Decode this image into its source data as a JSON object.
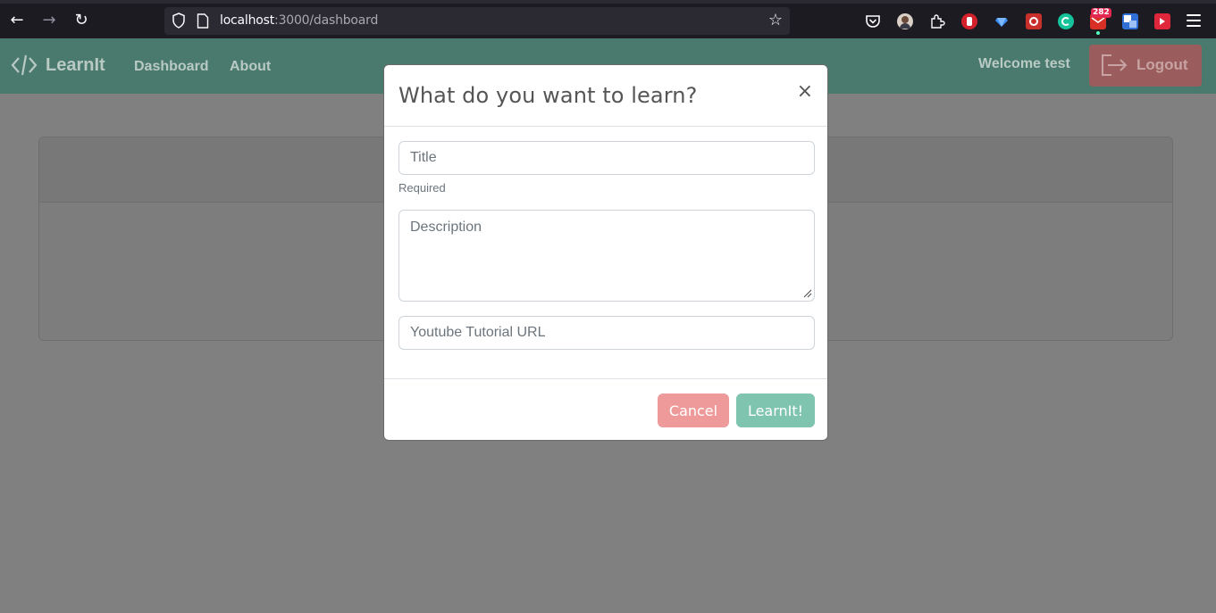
{
  "browser": {
    "url_host": "localhost",
    "url_path": ":3000/dashboard",
    "badge_count": "282"
  },
  "navbar": {
    "brand": "LearnIt",
    "links": [
      "Dashboard",
      "About"
    ],
    "welcome": "Welcome test",
    "logout_label": "Logout"
  },
  "modal": {
    "title": "What do you want to learn?",
    "close_symbol": "×",
    "title_placeholder": "Title",
    "title_hint": "Required",
    "description_placeholder": "Description",
    "url_placeholder": "Youtube Tutorial URL",
    "cancel_label": "Cancel",
    "submit_label": "LearnIt!"
  },
  "colors": {
    "overlay": "#808080",
    "navbar": "#4a7a6d",
    "cancel": "#ef9a9a",
    "submit": "#7ec4ae"
  }
}
